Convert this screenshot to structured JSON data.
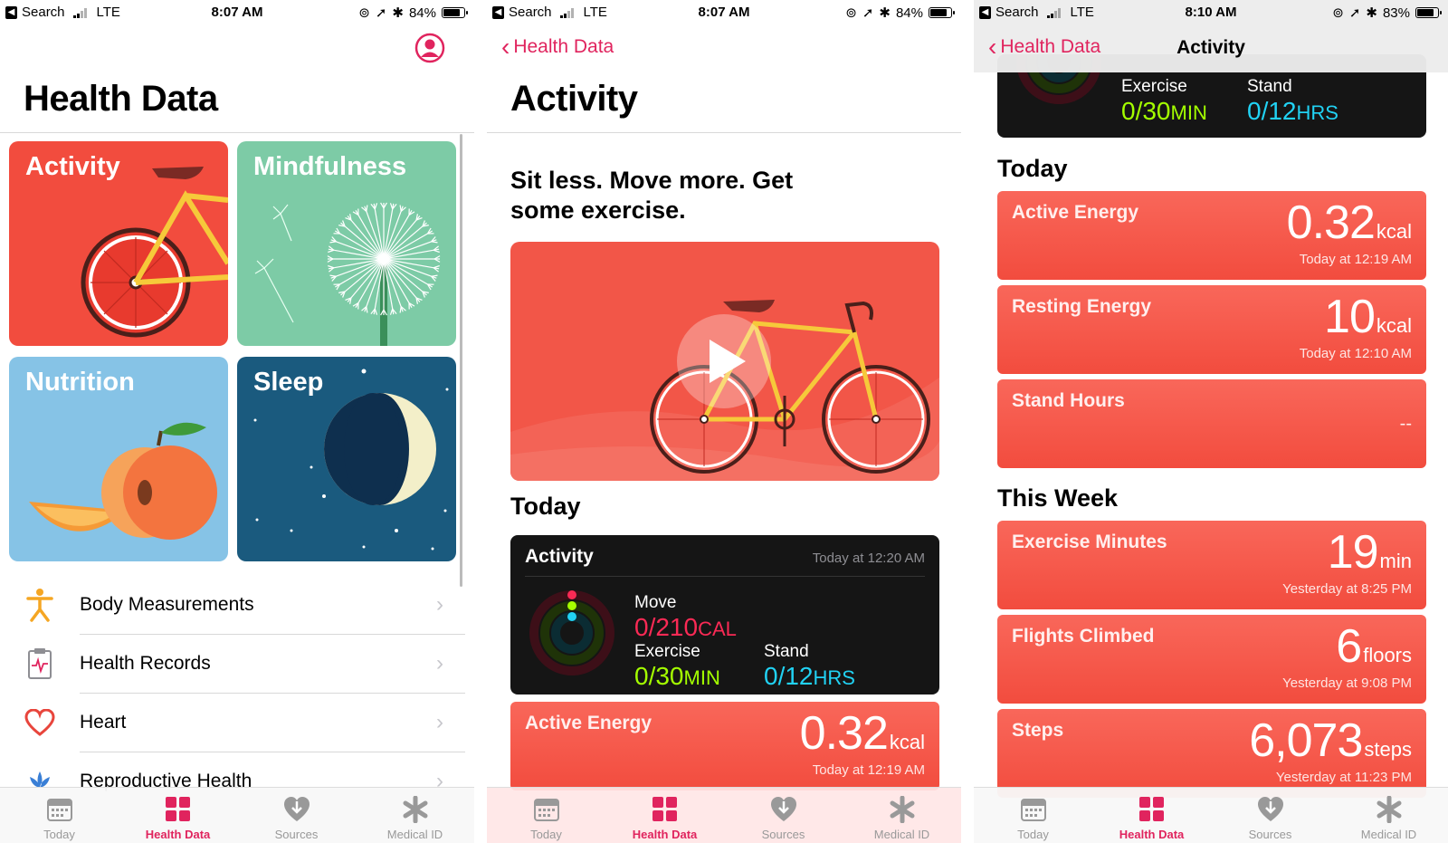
{
  "status": [
    {
      "back_app": "Search",
      "network": "LTE",
      "time": "8:07 AM",
      "battery": "84%",
      "battery_level": 0.84
    },
    {
      "back_app": "Search",
      "network": "LTE",
      "time": "8:07 AM",
      "battery": "84%",
      "battery_level": 0.84
    },
    {
      "back_app": "Search",
      "network": "LTE",
      "time": "8:10 AM",
      "battery": "83%",
      "battery_level": 0.83
    }
  ],
  "panel1": {
    "title": "Health Data",
    "tiles": [
      "Activity",
      "Mindfulness",
      "Nutrition",
      "Sleep"
    ],
    "list": [
      "Body Measurements",
      "Health Records",
      "Heart",
      "Reproductive Health"
    ]
  },
  "panel2": {
    "back": "Health Data",
    "title": "Activity",
    "headline": "Sit less. Move more. Get some exercise.",
    "today": "Today",
    "summary": {
      "title": "Activity",
      "date": "Today at 12:20 AM",
      "move_label": "Move",
      "move_value": "0/210",
      "move_unit": "CAL",
      "exercise_label": "Exercise",
      "exercise_value": "0/30",
      "exercise_unit": "MIN",
      "stand_label": "Stand",
      "stand_value": "0/12",
      "stand_unit": "HRS"
    },
    "card": {
      "name": "Active Energy",
      "value": "0.32",
      "unit": "kcal",
      "date": "Today at 12:19 AM"
    }
  },
  "panel3": {
    "back": "Health Data",
    "title": "Activity",
    "summary": {
      "exercise_label": "Exercise",
      "exercise_value": "0/30",
      "exercise_unit": "MIN",
      "stand_label": "Stand",
      "stand_value": "0/12",
      "stand_unit": "HRS"
    },
    "today": "Today",
    "today_cards": [
      {
        "name": "Active Energy",
        "value": "0.32",
        "unit": "kcal",
        "date": "Today at 12:19 AM"
      },
      {
        "name": "Resting Energy",
        "value": "10",
        "unit": "kcal",
        "date": "Today at 12:10 AM"
      },
      {
        "name": "Stand Hours",
        "empty": "--"
      }
    ],
    "this_week": "This Week",
    "week_cards": [
      {
        "name": "Exercise Minutes",
        "value": "19",
        "unit": "min",
        "date": "Yesterday at 8:25 PM"
      },
      {
        "name": "Flights Climbed",
        "value": "6",
        "unit": "floors",
        "date": "Yesterday at 9:08 PM"
      },
      {
        "name": "Steps",
        "value": "6,073",
        "unit": "steps",
        "date": "Yesterday at 11:23 PM"
      }
    ]
  },
  "tabs": [
    "Today",
    "Health Data",
    "Sources",
    "Medical ID"
  ],
  "colors": {
    "accent": "#e0245e",
    "activity_red": "#f24c3e",
    "mindfulness_green": "#7dcba6",
    "nutrition_blue": "#86c3e6",
    "sleep_navy": "#1a5a7e",
    "move": "#fa2a55",
    "exercise": "#a4ff00",
    "stand": "#21d2f4"
  }
}
